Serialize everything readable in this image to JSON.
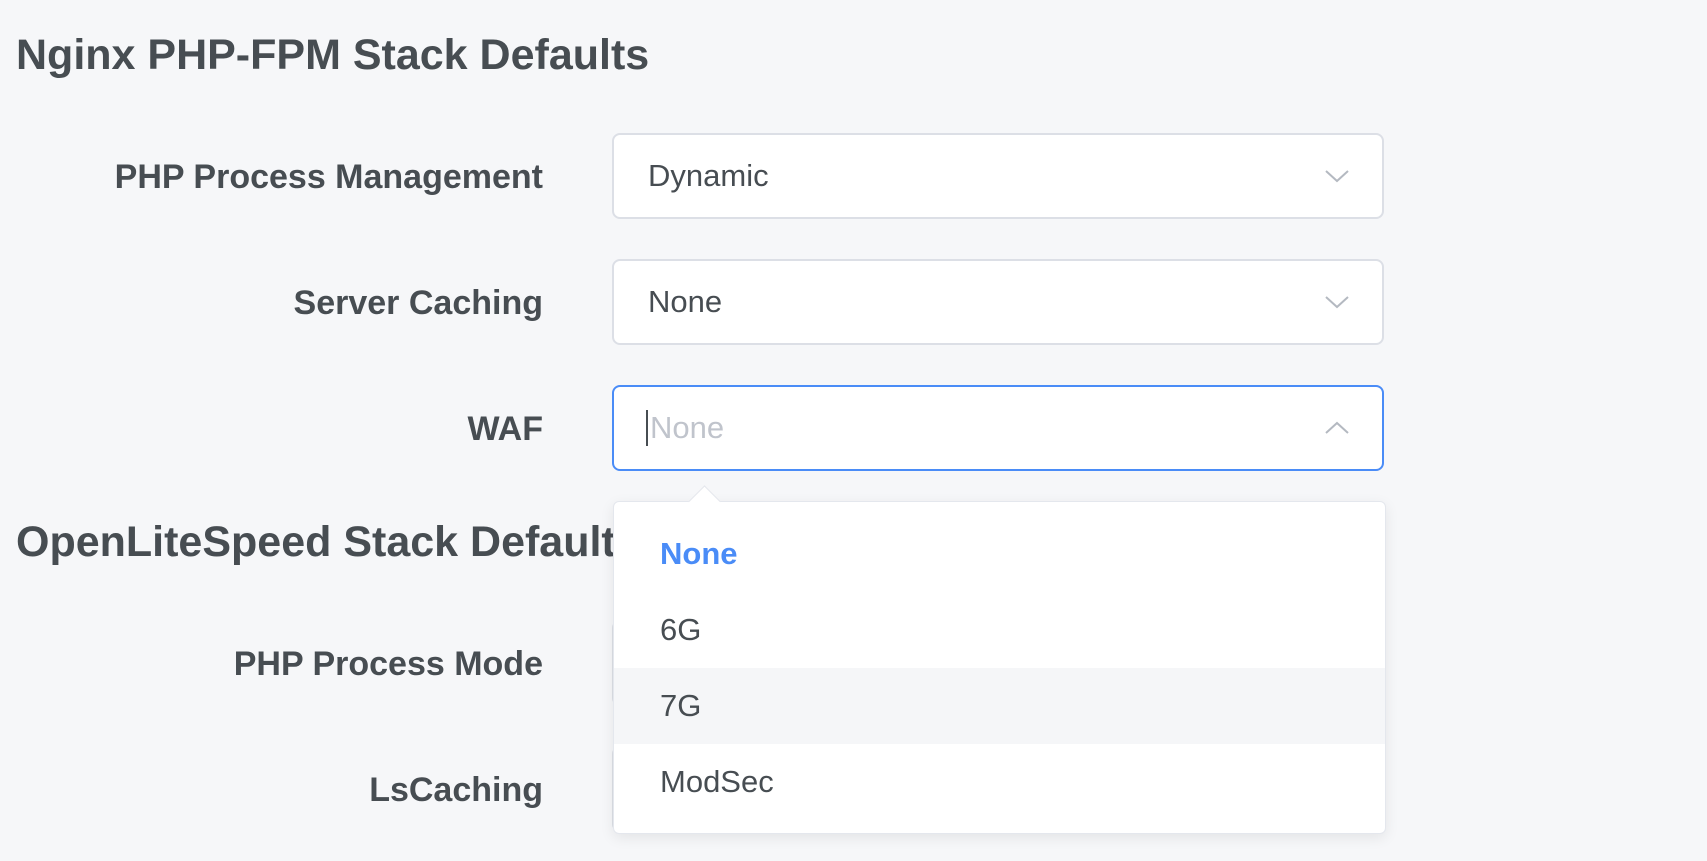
{
  "nginx_section": {
    "title": "Nginx PHP-FPM Stack Defaults",
    "fields": {
      "php_process_management": {
        "label": "PHP Process Management",
        "value": "Dynamic"
      },
      "server_caching": {
        "label": "Server Caching",
        "value": "None"
      },
      "waf": {
        "label": "WAF",
        "placeholder": "None"
      }
    }
  },
  "ols_section": {
    "title": "OpenLiteSpeed Stack Defaults",
    "fields": {
      "php_process_mode": {
        "label": "PHP Process Mode"
      },
      "lscaching": {
        "label": "LsCaching"
      }
    }
  },
  "waf_dropdown": {
    "options": [
      "None",
      "6G",
      "7G",
      "ModSec"
    ],
    "selected": "None",
    "hovered": "7G"
  },
  "colors": {
    "background": "#f6f7f9",
    "text": "#474d52",
    "accent": "#4a8cf7",
    "border": "#dcdfe6",
    "placeholder": "#c0c4cc"
  },
  "icons": {
    "collapsed": "chevron-down-icon",
    "expanded": "chevron-up-icon"
  }
}
